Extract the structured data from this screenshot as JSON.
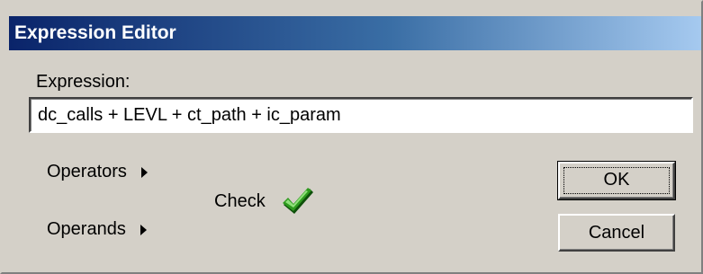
{
  "window": {
    "title": "Expression Editor"
  },
  "expression": {
    "label": "Expression:",
    "value": "dc_calls + LEVL + ct_path + ic_param"
  },
  "menus": {
    "operators_label": "Operators",
    "operands_label": "Operands"
  },
  "check": {
    "label": "Check",
    "icon": "checkmark-icon",
    "icon_color": "#2e9a1e"
  },
  "buttons": {
    "ok_label": "OK",
    "cancel_label": "Cancel"
  },
  "colors": {
    "titlebar_start": "#0a246a",
    "titlebar_end": "#a6caf0",
    "dialog_face": "#d4d0c8"
  }
}
